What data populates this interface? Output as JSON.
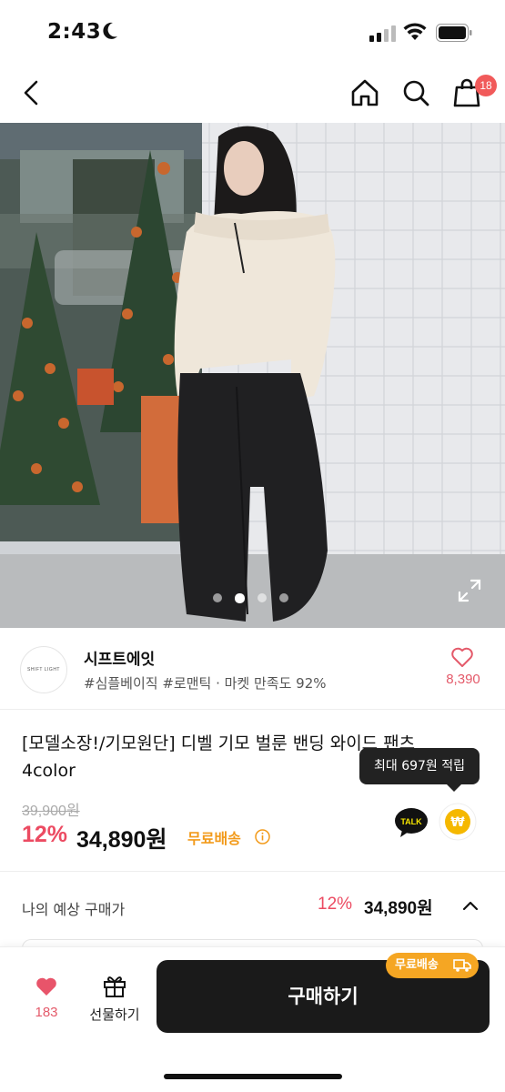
{
  "status_bar": {
    "time": "2:43"
  },
  "header": {
    "cart_count": "18"
  },
  "gallery": {
    "total": 4,
    "active_index": 1
  },
  "shop": {
    "logo_text": "SHIFT LIGHT",
    "name": "시프트에잇",
    "tags": "#심플베이직 #로맨틱 · 마켓 만족도 92%",
    "likes": "8,390"
  },
  "product": {
    "title": "[모델소장!/기모원단]  디벨 기모 벌룬 밴딩 와이드 팬츠 4color",
    "tooltip": "최대 697원 적립",
    "original_price": "39,900원",
    "discount": "12%",
    "price": "34,890원",
    "shipping": "무료배송",
    "talk_label": "TALK",
    "coin_symbol": "₩"
  },
  "estimate": {
    "label": "나의 예상 구매가",
    "discount": "12%",
    "price": "34,890원"
  },
  "bottom_bar": {
    "like_count": "183",
    "gift_label": "선물하기",
    "buy_label": "구매하기",
    "ship_chip": "무료배송"
  },
  "colors": {
    "accent_red": "#ec4b62",
    "shipping_orange": "#f29a1a",
    "buy_button": "#1a1a1a"
  }
}
